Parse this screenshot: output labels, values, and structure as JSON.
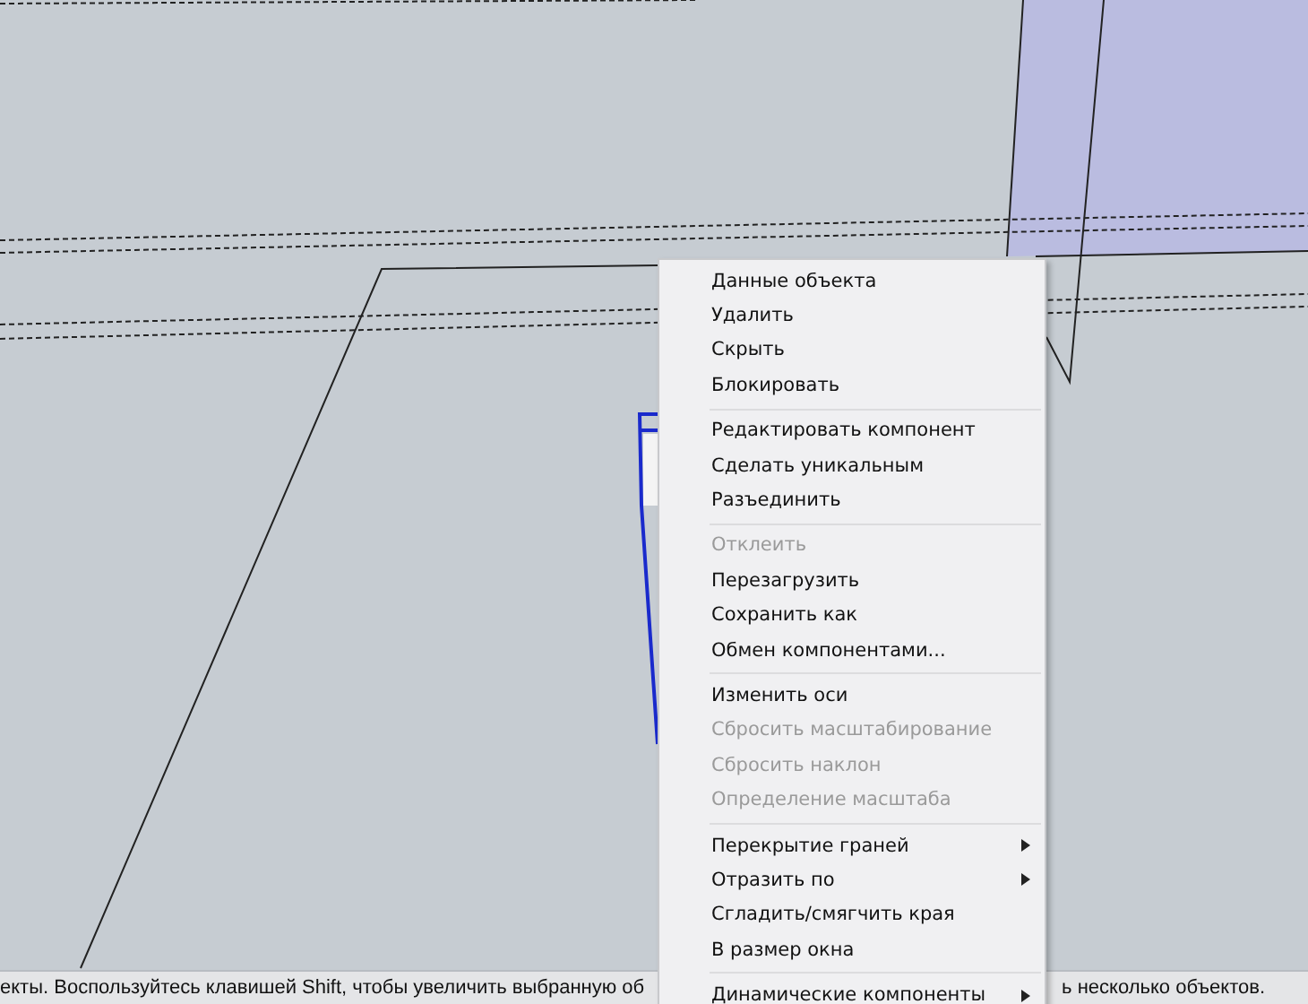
{
  "context_menu": {
    "groups": [
      {
        "items": [
          {
            "label": "Данные объекта",
            "disabled": false,
            "submenu": false
          },
          {
            "label": "Удалить",
            "disabled": false,
            "submenu": false
          },
          {
            "label": "Скрыть",
            "disabled": false,
            "submenu": false
          },
          {
            "label": "Блокировать",
            "disabled": false,
            "submenu": false
          }
        ]
      },
      {
        "items": [
          {
            "label": "Редактировать компонент",
            "disabled": false,
            "submenu": false
          },
          {
            "label": "Сделать уникальным",
            "disabled": false,
            "submenu": false
          },
          {
            "label": "Разъединить",
            "disabled": false,
            "submenu": false
          }
        ]
      },
      {
        "items": [
          {
            "label": "Отклеить",
            "disabled": true,
            "submenu": false
          },
          {
            "label": "Перезагрузить",
            "disabled": false,
            "submenu": false
          },
          {
            "label": "Сохранить как",
            "disabled": false,
            "submenu": false
          },
          {
            "label": "Обмен компонентами...",
            "disabled": false,
            "submenu": false
          }
        ]
      },
      {
        "items": [
          {
            "label": "Изменить оси",
            "disabled": false,
            "submenu": false
          },
          {
            "label": "Сбросить масштабирование",
            "disabled": true,
            "submenu": false
          },
          {
            "label": "Сбросить наклон",
            "disabled": true,
            "submenu": false
          },
          {
            "label": "Определение масштаба",
            "disabled": true,
            "submenu": false
          }
        ]
      },
      {
        "items": [
          {
            "label": "Перекрытие граней",
            "disabled": false,
            "submenu": true
          },
          {
            "label": "Отразить по",
            "disabled": false,
            "submenu": true
          },
          {
            "label": "Сгладить/смягчить края",
            "disabled": false,
            "submenu": false
          },
          {
            "label": "В размер окна",
            "disabled": false,
            "submenu": false
          }
        ]
      },
      {
        "items": [
          {
            "label": "Динамические компоненты",
            "disabled": false,
            "submenu": true
          }
        ]
      }
    ]
  },
  "status_bar": {
    "text_left": "екты. Воспользуйтесь клавишей Shift, чтобы увеличить выбранную об",
    "text_right": "ь несколько объектов."
  }
}
